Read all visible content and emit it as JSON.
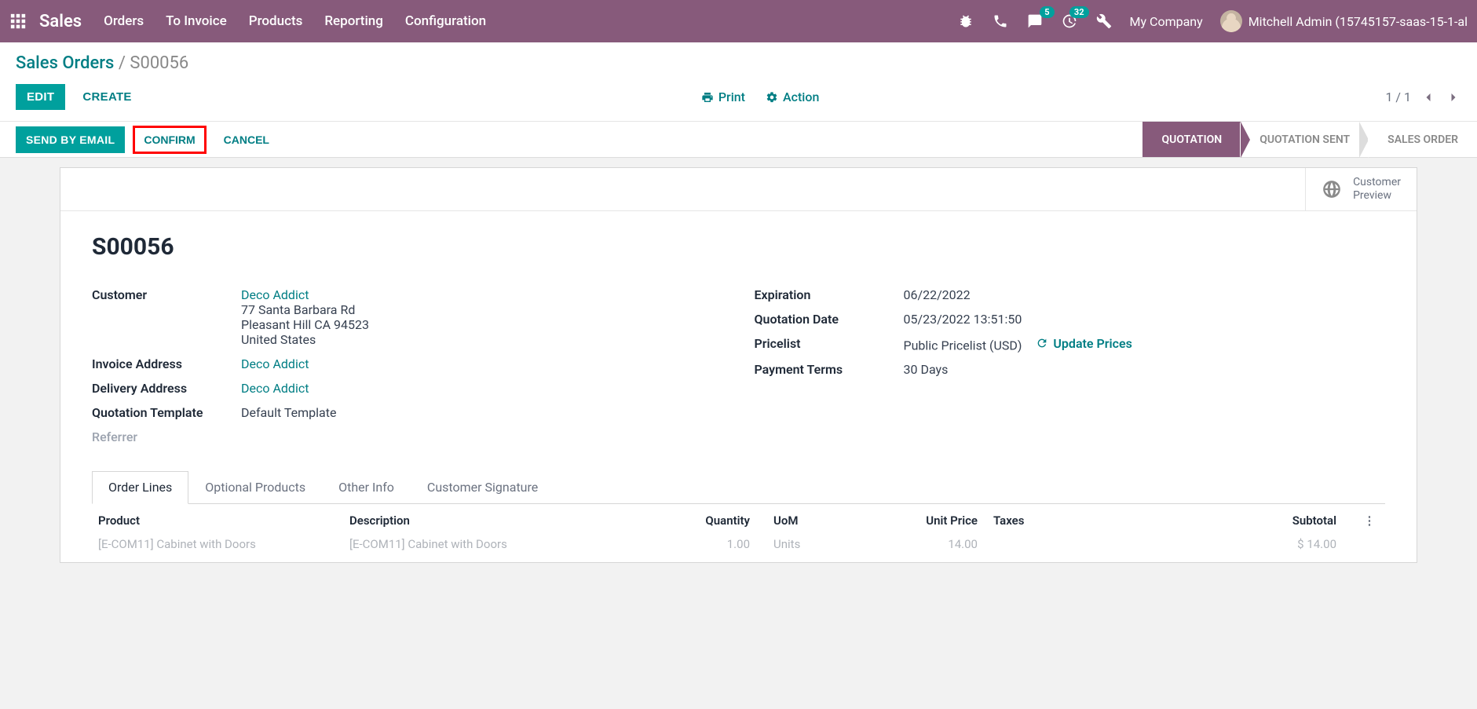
{
  "colors": {
    "primary": "#875A7B",
    "teal": "#00a09d",
    "link": "#017e84"
  },
  "nav": {
    "brand": "Sales",
    "menu": [
      "Orders",
      "To Invoice",
      "Products",
      "Reporting",
      "Configuration"
    ],
    "msg_badge": "5",
    "activity_badge": "32",
    "company": "My Company",
    "user": "Mitchell Admin (15745157-saas-15-1-al"
  },
  "breadcrumb": {
    "root": "Sales Orders",
    "sep": "/",
    "current": "S00056"
  },
  "toolbar": {
    "edit": "EDIT",
    "create": "CREATE",
    "print": "Print",
    "action": "Action",
    "pager": "1 / 1"
  },
  "actions": {
    "send": "SEND BY EMAIL",
    "confirm": "CONFIRM",
    "cancel": "CANCEL"
  },
  "status": [
    "QUOTATION",
    "QUOTATION SENT",
    "SALES ORDER"
  ],
  "stat": {
    "line1": "Customer",
    "line2": "Preview"
  },
  "record": {
    "name": "S00056",
    "left": {
      "customer_label": "Customer",
      "customer_name": "Deco Addict",
      "addr1": "77 Santa Barbara Rd",
      "addr2": "Pleasant Hill CA 94523",
      "addr3": "United States",
      "invoice_label": "Invoice Address",
      "invoice_val": "Deco Addict",
      "delivery_label": "Delivery Address",
      "delivery_val": "Deco Addict",
      "template_label": "Quotation Template",
      "template_val": "Default Template",
      "referrer_label": "Referrer"
    },
    "right": {
      "exp_label": "Expiration",
      "exp_val": "06/22/2022",
      "qdate_label": "Quotation Date",
      "qdate_val": "05/23/2022 13:51:50",
      "pricelist_label": "Pricelist",
      "pricelist_val": "Public Pricelist (USD)",
      "update_prices": "Update Prices",
      "terms_label": "Payment Terms",
      "terms_val": "30 Days"
    }
  },
  "tabs": [
    "Order Lines",
    "Optional Products",
    "Other Info",
    "Customer Signature"
  ],
  "table": {
    "headers": {
      "product": "Product",
      "desc": "Description",
      "qty": "Quantity",
      "uom": "UoM",
      "price": "Unit Price",
      "taxes": "Taxes",
      "subtotal": "Subtotal"
    },
    "row": {
      "product": "[E-COM11] Cabinet with Doors",
      "desc": "[E-COM11] Cabinet with Doors",
      "qty": "1.00",
      "uom": "Units",
      "price": "14.00",
      "subtotal": "$ 14.00"
    }
  }
}
